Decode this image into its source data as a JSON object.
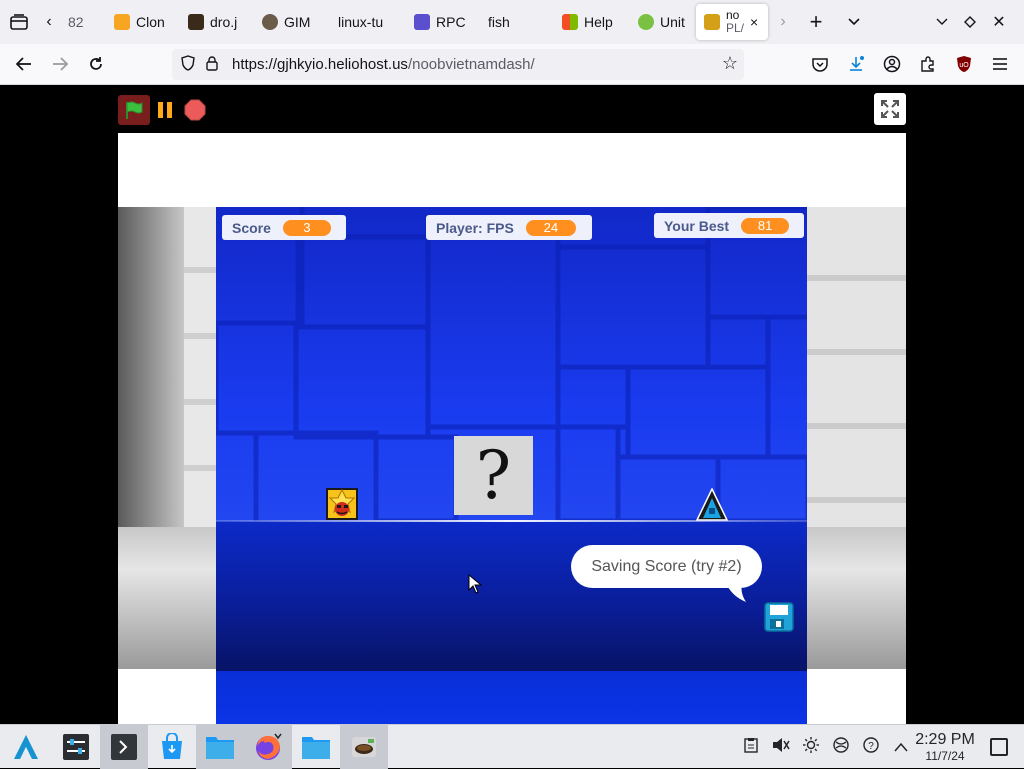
{
  "browser": {
    "tabs": [
      {
        "label": "82",
        "favicon_color": "#ffffff"
      },
      {
        "label": "Clon",
        "favicon_color": "#f6a623"
      },
      {
        "label": "dro.j",
        "favicon_color": "#3a2a1a"
      },
      {
        "label": "GIM",
        "favicon_color": "#6b5b4b"
      },
      {
        "label": "linux-tu",
        "favicon_color": "#f0f0f4"
      },
      {
        "label": "RPC",
        "favicon_color": "#5a4fcf"
      },
      {
        "label": "fish",
        "favicon_color": "#f0f0f4"
      },
      {
        "label": "Help",
        "favicon_color": "#f25022"
      },
      {
        "label": "Unit",
        "favicon_color": "#7ac143"
      }
    ],
    "active_tab": {
      "line1": "no",
      "line2": "PL/",
      "favicon_color": "#d4a017",
      "close": "×"
    },
    "url_host": "https://gjhkyio.heliohost.us",
    "url_path": "/noobvietnamdash/",
    "icons": {
      "tab_list": "tab-list-icon",
      "back": "arrow-left-icon",
      "forward": "arrow-right-icon",
      "reload": "reload-icon",
      "shield": "tracking-shield-icon",
      "lock": "lock-icon",
      "star": "bookmark-star-icon"
    }
  },
  "game": {
    "hud": {
      "score_label": "Score",
      "score_value": "3",
      "fps_label": "Player: FPS",
      "fps_value": "24",
      "best_label": "Your Best",
      "best_value": "81"
    },
    "mystery_text": "?",
    "speech": "Saving Score (try #2)",
    "colors": {
      "hud_pill": "#ff8f1f",
      "stage_blue": "#1a3cf0",
      "flag_green": "#3cbf3c",
      "pause_orange": "#ffab19",
      "stop_red": "#ec5a5a"
    }
  },
  "taskbar": {
    "clock_time": "2:29 PM",
    "clock_date": "11/7/24",
    "apps": [
      "app-launcher-icon",
      "settings-icon",
      "terminal-icon",
      "discover-icon",
      "files-icon",
      "firefox-icon",
      "folder-icon",
      "tea-icon"
    ]
  }
}
